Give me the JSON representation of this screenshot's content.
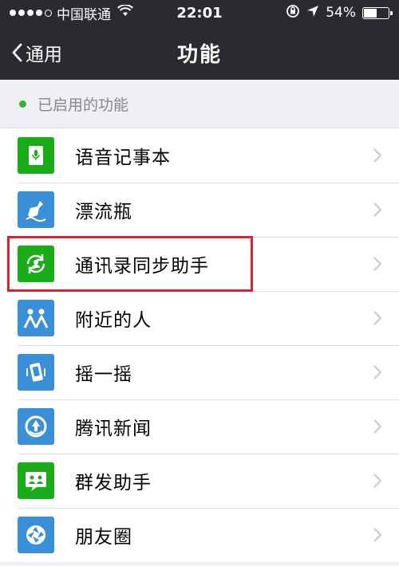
{
  "status_bar": {
    "carrier": "中国联通",
    "time": "22:01",
    "battery": "54%",
    "battery_level": 0.54
  },
  "nav": {
    "back_label": "通用",
    "title": "功能"
  },
  "section": {
    "header": "已启用的功能"
  },
  "items": [
    {
      "label": "语音记事本",
      "icon": "voice-notepad-icon",
      "color": "#1aad19"
    },
    {
      "label": "漂流瓶",
      "icon": "drift-bottle-icon",
      "color": "#3b8fd6"
    },
    {
      "label": "通讯录同步助手",
      "icon": "contact-sync-icon",
      "color": "#1aad19"
    },
    {
      "label": "附近的人",
      "icon": "people-nearby-icon",
      "color": "#3b8fd6"
    },
    {
      "label": "摇一摇",
      "icon": "shake-icon",
      "color": "#3b8fd6"
    },
    {
      "label": "腾讯新闻",
      "icon": "tencent-news-icon",
      "color": "#3b8fd6"
    },
    {
      "label": "群发助手",
      "icon": "broadcast-assistant-icon",
      "color": "#1aad19"
    },
    {
      "label": "朋友圈",
      "icon": "moments-icon",
      "color": "#3b8fd6"
    }
  ],
  "highlight_color": "#d9262e"
}
